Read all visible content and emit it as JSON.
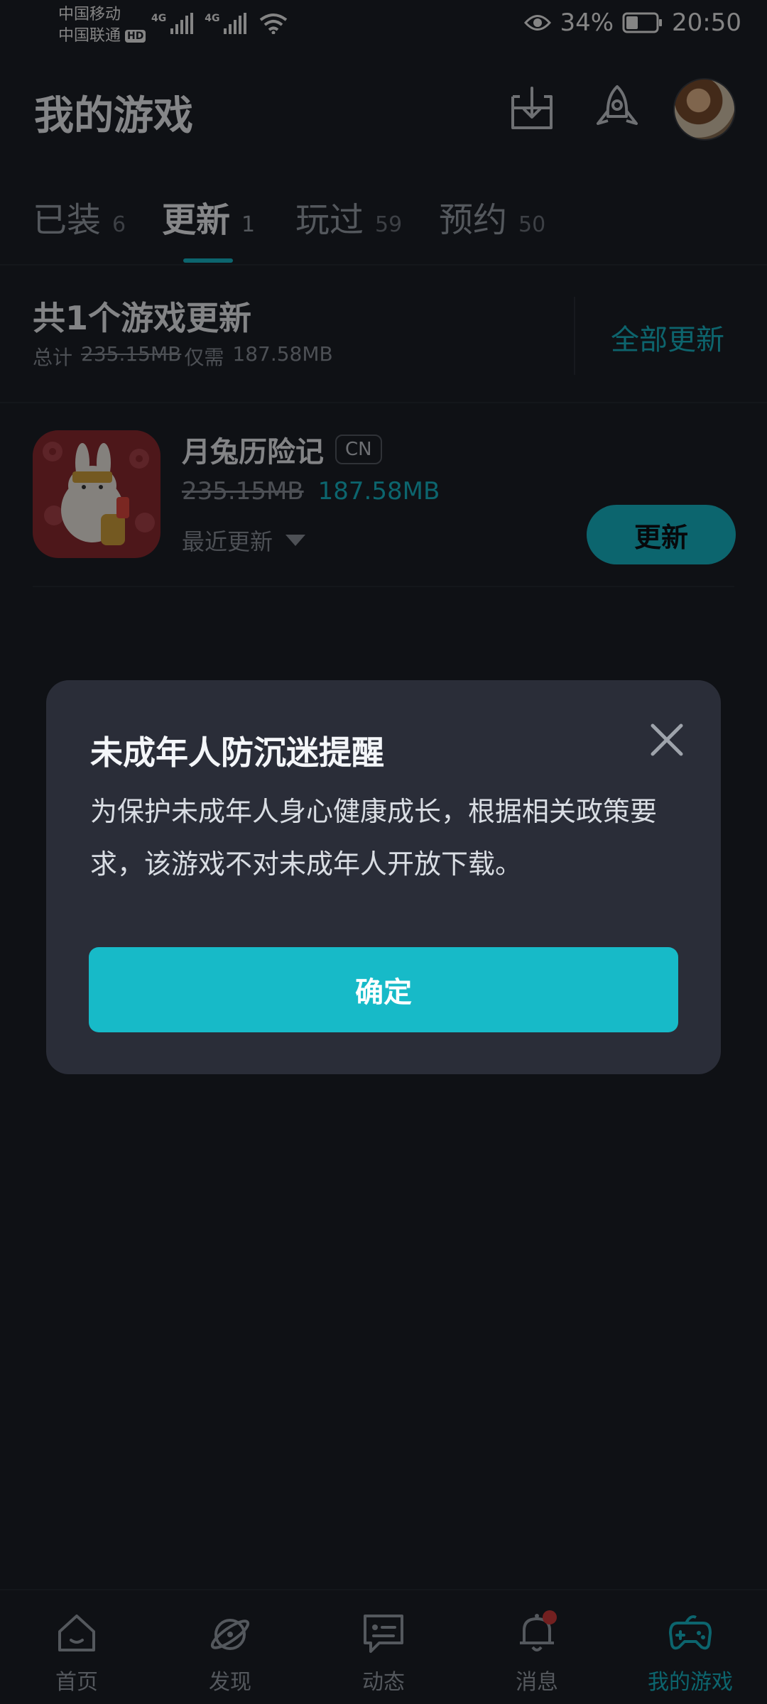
{
  "status_bar": {
    "carrier1": "中国移动",
    "carrier2": "中国联通",
    "hd": "HD",
    "network1": "4G",
    "network2": "4G",
    "battery": "34%",
    "time": "20:50"
  },
  "header": {
    "title": "我的游戏",
    "icons": [
      "download-icon",
      "rocket-icon",
      "avatar"
    ]
  },
  "tabs": [
    {
      "label": "已装",
      "count": "6"
    },
    {
      "label": "更新",
      "count": "1",
      "active": true
    },
    {
      "label": "玩过",
      "count": "59"
    },
    {
      "label": "预约",
      "count": "50"
    }
  ],
  "summary": {
    "title": "共1个游戏更新",
    "total_label": "总计",
    "total_size": "235.15MB",
    "only_label": "仅需",
    "needed_size": "187.58MB",
    "update_all": "全部更新"
  },
  "game": {
    "name": "月兔历险记",
    "region_badge": "CN",
    "old_size": "235.15MB",
    "new_size": "187.58MB",
    "recent_label": "最近更新",
    "update_button": "更新"
  },
  "dialog": {
    "title": "未成年人防沉迷提醒",
    "body": "为保护未成年人身心健康成长，根据相关政策要求，该游戏不对未成年人开放下载。",
    "confirm": "确定"
  },
  "bottom_nav": [
    {
      "label": "首页",
      "icon": "home-icon"
    },
    {
      "label": "发现",
      "icon": "discover-icon"
    },
    {
      "label": "动态",
      "icon": "feed-icon"
    },
    {
      "label": "消息",
      "icon": "bell-icon"
    },
    {
      "label": "我的游戏",
      "icon": "gamepad-icon",
      "active": true
    }
  ],
  "colors": {
    "accent": "#17b9c8",
    "background": "#1c1f27",
    "dialog": "#2a2d38",
    "notification_dot": "#d23b3b"
  }
}
